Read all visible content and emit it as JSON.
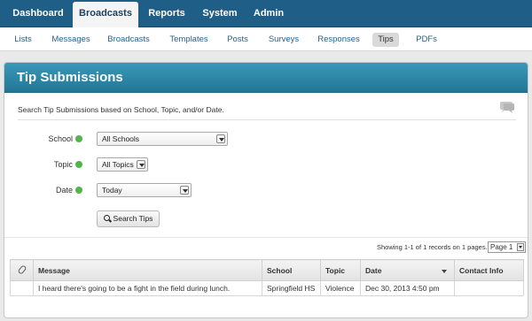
{
  "topnav": {
    "tabs": [
      {
        "label": "Dashboard"
      },
      {
        "label": "Broadcasts"
      },
      {
        "label": "Reports"
      },
      {
        "label": "System"
      },
      {
        "label": "Admin"
      }
    ]
  },
  "subnav": {
    "items": [
      {
        "label": "Lists"
      },
      {
        "label": "Messages"
      },
      {
        "label": "Broadcasts"
      },
      {
        "label": "Templates"
      },
      {
        "label": "Posts"
      },
      {
        "label": "Surveys"
      },
      {
        "label": "Responses"
      },
      {
        "label": "Tips"
      },
      {
        "label": "PDFs"
      }
    ],
    "active": "Tips"
  },
  "panel": {
    "title": "Tip Submissions",
    "description": "Search Tip Submissions based on School, Topic, and/or Date."
  },
  "form": {
    "school_label": "School",
    "school_value": "All Schools",
    "topic_label": "Topic",
    "topic_value": "All Topics",
    "date_label": "Date",
    "date_value": "Today",
    "search_button": "Search Tips"
  },
  "results": {
    "summary": "Showing 1-1 of 1 records on 1 pages.",
    "page_value": "Page 1"
  },
  "table": {
    "headers": [
      "Message",
      "School",
      "Topic",
      "Date",
      "Contact Info"
    ],
    "rows": [
      {
        "message": "I heard there's going to be a fight in the field during lunch.",
        "school": "Springfield HS",
        "topic": "Violence",
        "date": "Dec 30, 2013 4:50 pm",
        "contact": ""
      }
    ]
  },
  "colors": {
    "topnav_bg": "#1f5f87",
    "panel_header": "#2a86a6",
    "check_green": "#54b34a"
  }
}
